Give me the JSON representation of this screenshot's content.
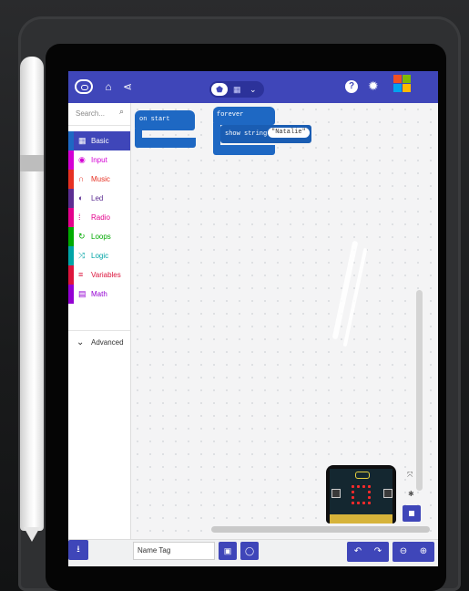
{
  "app": {
    "topbar": {
      "home_icon": "home-icon",
      "share_icon": "share-icon",
      "toggle_mid": "▦",
      "help_label": "?",
      "settings_icon": "gear-icon"
    },
    "toolbox": {
      "search_placeholder": "Search...",
      "categories": [
        {
          "label": "Basic",
          "icon": "grid-icon",
          "color": "#1e68c3"
        },
        {
          "label": "Input",
          "icon": "target-icon",
          "color": "#d400d4"
        },
        {
          "label": "Music",
          "icon": "headphones-icon",
          "color": "#e63022"
        },
        {
          "label": "Led",
          "icon": "toggle-icon",
          "color": "#5c2d91"
        },
        {
          "label": "Radio",
          "icon": "signal-icon",
          "color": "#e3008c"
        },
        {
          "label": "Loops",
          "icon": "refresh-icon",
          "color": "#00aa00"
        },
        {
          "label": "Logic",
          "icon": "shuffle-icon",
          "color": "#00a4a6"
        },
        {
          "label": "Variables",
          "icon": "list-icon",
          "color": "#dc143c"
        },
        {
          "label": "Math",
          "icon": "calculator-icon",
          "color": "#9400d3"
        }
      ],
      "advanced_label": "Advanced"
    },
    "workspace": {
      "on_start_label": "on start",
      "forever_label": "forever",
      "show_string_label": "show string",
      "string_value": "\"Natalie\""
    },
    "bottombar": {
      "project_name": "Name Tag"
    },
    "colors": {
      "brand": "#3f46b9",
      "block_basic": "#1e68c3",
      "led_on": "#ff2a2a"
    }
  }
}
